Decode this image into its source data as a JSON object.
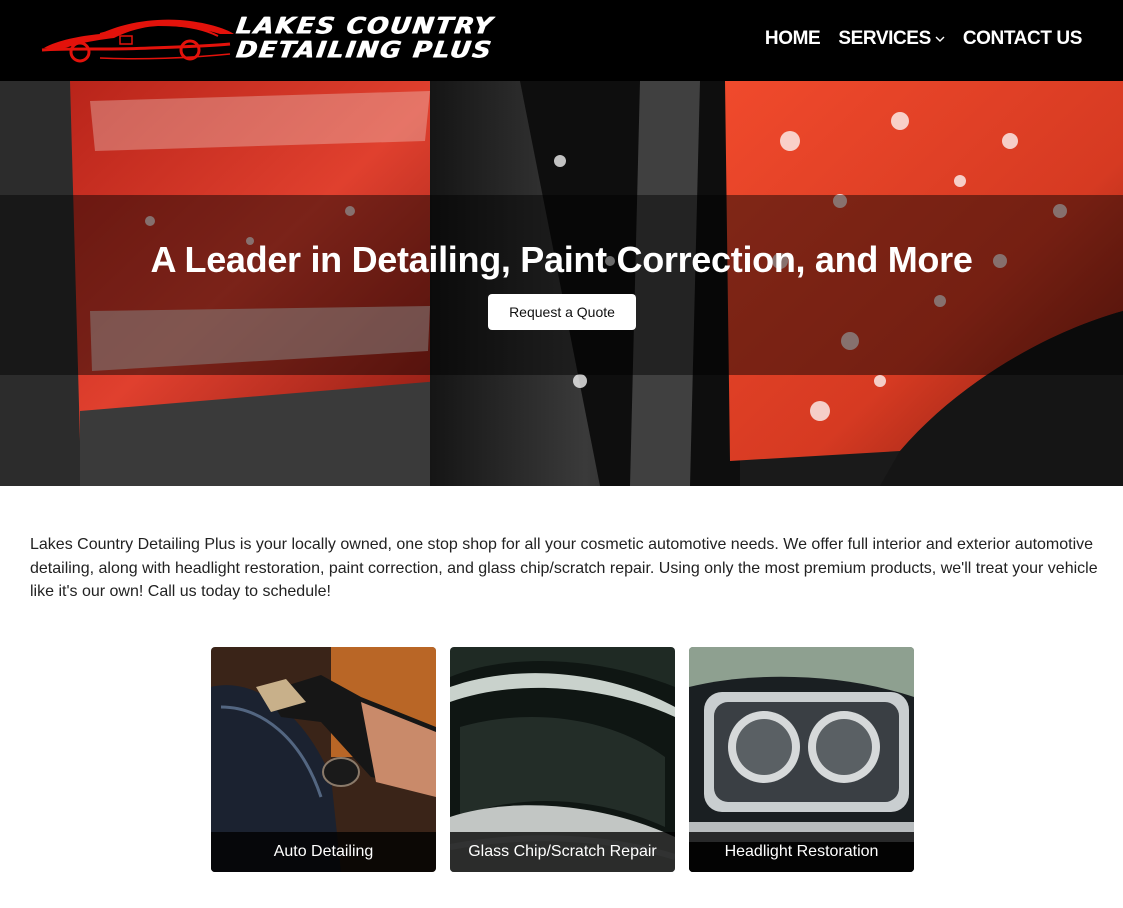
{
  "brand": {
    "logo_line1": "LAKES COUNTRY",
    "logo_line2": "DETAILING PLUS",
    "accent_color": "#e3120b"
  },
  "nav": {
    "home": "HOME",
    "services": "SERVICES",
    "services_icon": "chevron-down-icon",
    "contact": "CONTACT US"
  },
  "hero": {
    "title": "A Leader in Detailing, Paint Correction, and More",
    "button_label": "Request a Quote"
  },
  "intro": {
    "text": "Lakes Country Detailing Plus is your locally owned, one stop shop for all your cosmetic automotive needs. We offer full interior and exterior automotive detailing, along with headlight restoration, paint correction, and glass chip/scratch repair. Using only the most premium products, we'll treat your vehicle like it's our own! Call us today to schedule!"
  },
  "services": [
    {
      "label": "Auto Detailing"
    },
    {
      "label": "Glass Chip/Scratch Repair"
    },
    {
      "label": "Headlight Restoration"
    }
  ]
}
